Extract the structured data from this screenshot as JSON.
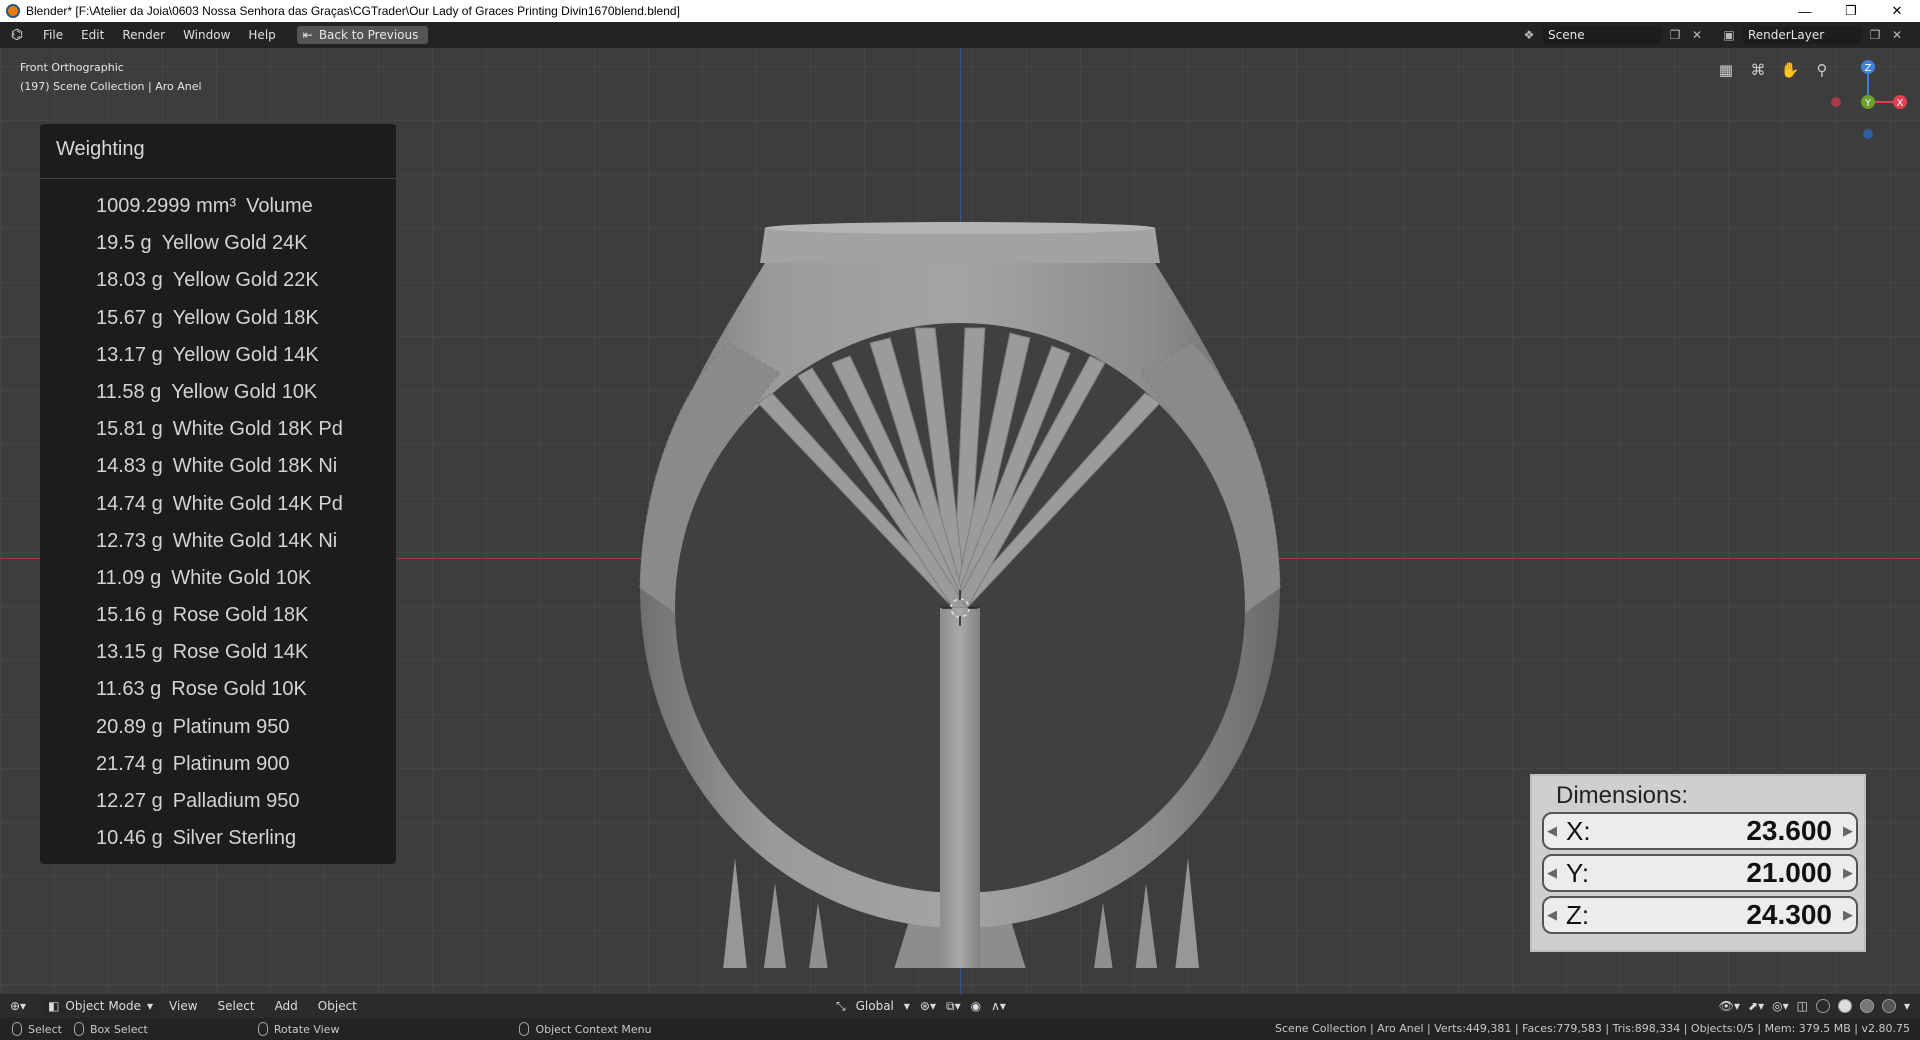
{
  "window": {
    "title": "Blender* [F:\\Atelier da Joia\\0603 Nossa Senhora das Graças\\CGTrader\\Our Lady of Graces Printing Divin1670blend.blend]",
    "minimize": "—",
    "maximize": "❐",
    "close": "✕"
  },
  "menubar": {
    "items": [
      "File",
      "Edit",
      "Render",
      "Window",
      "Help"
    ],
    "back_button": "Back to Previous",
    "scene": "Scene",
    "render_layer": "RenderLayer"
  },
  "viewport": {
    "view_name": "Front Orthographic",
    "collection_info": "(197) Scene Collection | Aro Anel"
  },
  "weighting": {
    "title": "Weighting",
    "rows": [
      {
        "amount": "1009.2999 mm³",
        "material": "Volume"
      },
      {
        "amount": "19.5 g",
        "material": "Yellow Gold 24K"
      },
      {
        "amount": "18.03 g",
        "material": "Yellow Gold 22K"
      },
      {
        "amount": "15.67 g",
        "material": "Yellow Gold 18K"
      },
      {
        "amount": "13.17 g",
        "material": "Yellow Gold 14K"
      },
      {
        "amount": "11.58 g",
        "material": "Yellow Gold 10K"
      },
      {
        "amount": "15.81 g",
        "material": "White Gold 18K Pd"
      },
      {
        "amount": "14.83 g",
        "material": "White Gold 18K Ni"
      },
      {
        "amount": "14.74 g",
        "material": "White Gold 14K Pd"
      },
      {
        "amount": "12.73 g",
        "material": "White Gold 14K Ni"
      },
      {
        "amount": "11.09 g",
        "material": "White Gold 10K"
      },
      {
        "amount": "15.16 g",
        "material": "Rose Gold 18K"
      },
      {
        "amount": "13.15 g",
        "material": "Rose Gold 14K"
      },
      {
        "amount": "11.63 g",
        "material": "Rose Gold 10K"
      },
      {
        "amount": "20.89 g",
        "material": "Platinum 950"
      },
      {
        "amount": "21.74 g",
        "material": "Platinum 900"
      },
      {
        "amount": "12.27 g",
        "material": "Palladium 950"
      },
      {
        "amount": "10.46 g",
        "material": "Silver Sterling"
      }
    ]
  },
  "dimensions": {
    "title": "Dimensions:",
    "x_label": "X:",
    "x_value": "23.600",
    "y_label": "Y:",
    "y_value": "21.000",
    "z_label": "Z:",
    "z_value": "24.300"
  },
  "gizmo": {
    "z": "Z",
    "y": "Y",
    "x": "X"
  },
  "header": {
    "mode": "Object Mode",
    "menus": [
      "View",
      "Select",
      "Add",
      "Object"
    ],
    "orientation": "Global"
  },
  "status": {
    "select": "Select",
    "box_select": "Box Select",
    "rotate_view": "Rotate View",
    "context_menu": "Object Context Menu",
    "stats": "Scene Collection | Aro Anel | Verts:449,381 | Faces:779,583 | Tris:898,334 | Objects:0/5 | Mem: 379.5 MB | v2.80.75"
  },
  "colors": {
    "accent_orange": "#e87d0d",
    "axis_red": "#9b3b3b",
    "axis_blue": "#2f5a9a",
    "gizmo_x": "#e0404f",
    "gizmo_y": "#6ca02a",
    "gizmo_z": "#3f7fd8"
  },
  "icons": [
    "blender-logo-icon",
    "grid-icon",
    "camera-icon",
    "hand-icon",
    "zoom-icon"
  ]
}
